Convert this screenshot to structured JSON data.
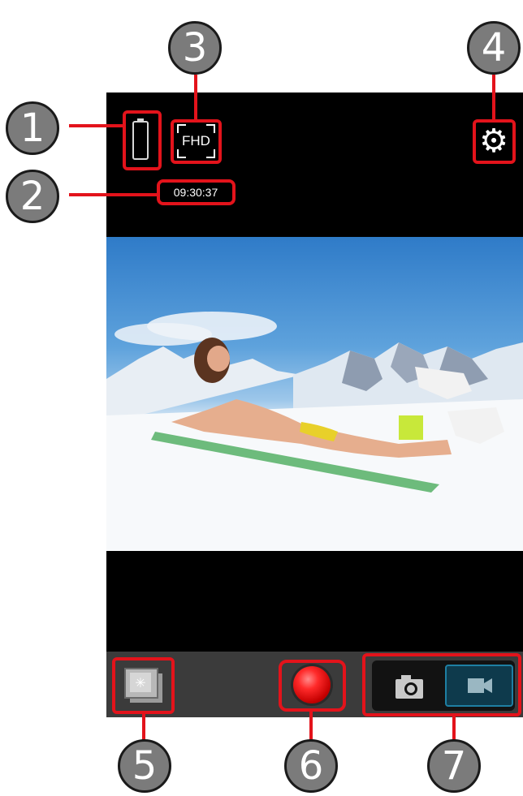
{
  "status": {
    "resolution_label": "FHD",
    "recording_time": "09:30:37"
  },
  "callouts": [
    "1",
    "2",
    "3",
    "4",
    "5",
    "6",
    "7"
  ],
  "colors": {
    "highlight": "#e3131b",
    "callout_fill": "#7b7b7b",
    "record": "#ff2a2a",
    "video_mode_active": "#1e7fa3"
  },
  "icons": {
    "battery": "battery-icon",
    "resolution": "fhd-resolution-icon",
    "settings": "gear-icon",
    "gallery": "gallery-icon",
    "record": "record-icon",
    "photo_mode": "camera-icon",
    "video_mode": "video-camera-icon"
  },
  "controls": {
    "active_mode": "video"
  }
}
